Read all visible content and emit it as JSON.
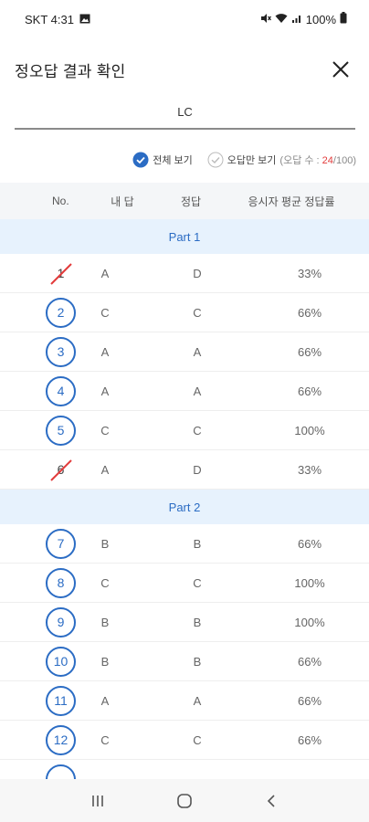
{
  "status_bar": {
    "carrier_time": "SKT 4:31",
    "battery": "100%"
  },
  "header": {
    "title": "정오답 결과 확인"
  },
  "tab": {
    "label": "LC"
  },
  "filter": {
    "all_label": "전체 보기",
    "wrong_only_label": "오답만 보기",
    "wrong_count_prefix": "(오답 수 : ",
    "wrong_count": "24",
    "wrong_count_suffix": "/100)"
  },
  "table": {
    "headers": {
      "no": "No.",
      "mine": "내 답",
      "answer": "정답",
      "rate": "응시자 평균 정답률"
    },
    "parts": [
      {
        "title": "Part 1",
        "rows": [
          {
            "num": "1",
            "mine": "A",
            "answer": "D",
            "rate": "33%",
            "correct": false
          },
          {
            "num": "2",
            "mine": "C",
            "answer": "C",
            "rate": "66%",
            "correct": true
          },
          {
            "num": "3",
            "mine": "A",
            "answer": "A",
            "rate": "66%",
            "correct": true
          },
          {
            "num": "4",
            "mine": "A",
            "answer": "A",
            "rate": "66%",
            "correct": true
          },
          {
            "num": "5",
            "mine": "C",
            "answer": "C",
            "rate": "100%",
            "correct": true
          },
          {
            "num": "6",
            "mine": "A",
            "answer": "D",
            "rate": "33%",
            "correct": false
          }
        ]
      },
      {
        "title": "Part 2",
        "rows": [
          {
            "num": "7",
            "mine": "B",
            "answer": "B",
            "rate": "66%",
            "correct": true
          },
          {
            "num": "8",
            "mine": "C",
            "answer": "C",
            "rate": "100%",
            "correct": true
          },
          {
            "num": "9",
            "mine": "B",
            "answer": "B",
            "rate": "100%",
            "correct": true
          },
          {
            "num": "10",
            "mine": "B",
            "answer": "B",
            "rate": "66%",
            "correct": true
          },
          {
            "num": "11",
            "mine": "A",
            "answer": "A",
            "rate": "66%",
            "correct": true
          },
          {
            "num": "12",
            "mine": "C",
            "answer": "C",
            "rate": "66%",
            "correct": true
          },
          {
            "num": "",
            "mine": "",
            "answer": "",
            "rate": "",
            "correct": true
          }
        ]
      }
    ]
  },
  "colors": {
    "accent": "#2b6cc4",
    "wrong_mark": "#e23b3b",
    "part_bg": "#e7f2fd"
  },
  "icons": {
    "close": "close-icon",
    "recents": "recents-icon",
    "home": "home-icon",
    "back": "back-icon"
  }
}
